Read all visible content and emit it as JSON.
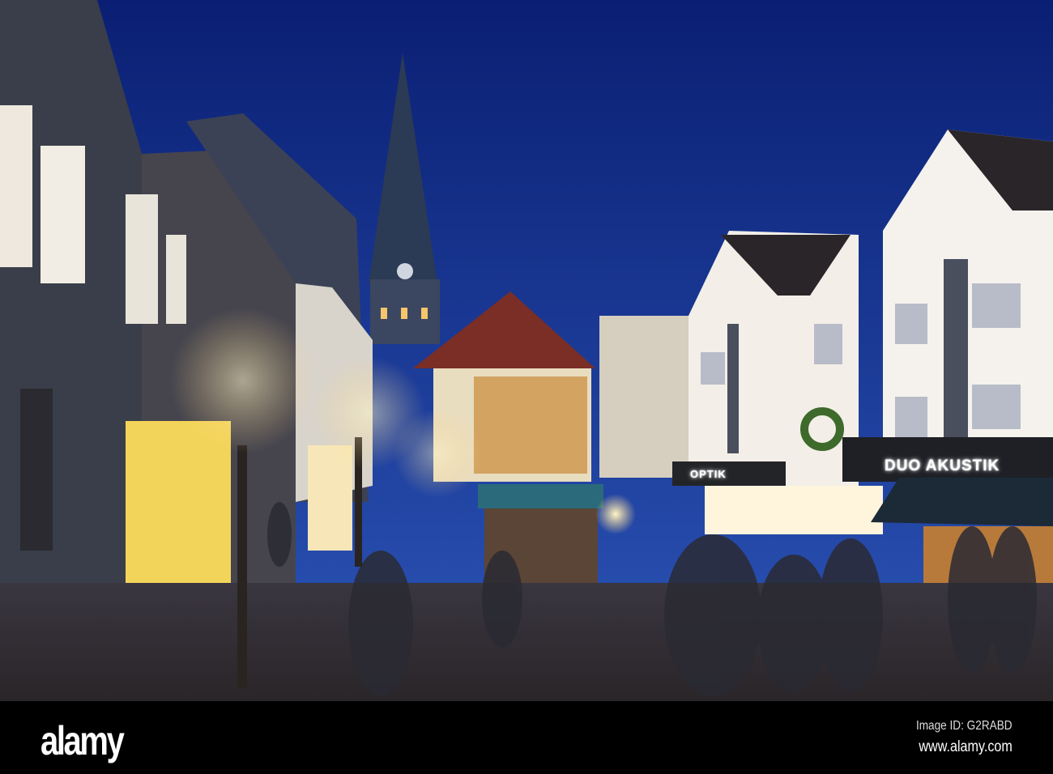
{
  "scene": {
    "description_tag": "evening christmas market street",
    "shop_signs": [
      "DUO AKUSTIK",
      "OPTIK"
    ],
    "colors": {
      "sky_top": "#0a1f73",
      "sky_bottom": "#2a4fb0",
      "lights": "#ffd27a"
    }
  },
  "watermark": {
    "logo": "alamy",
    "image_id": "Image ID: G2RABD",
    "url": "www.alamy.com"
  }
}
